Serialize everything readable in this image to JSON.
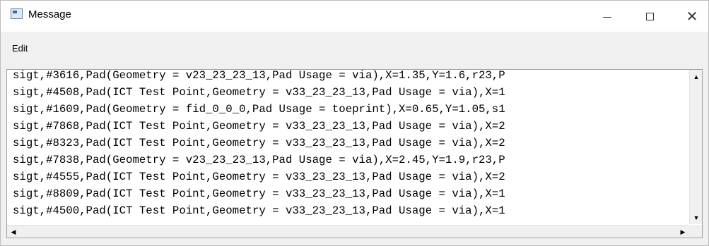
{
  "window": {
    "title": "Message",
    "app_icon": "app-window-icon",
    "controls": {
      "minimize": "minimize-icon",
      "maximize": "maximize-icon",
      "close": "close-icon"
    }
  },
  "menu": {
    "items": [
      "Edit"
    ]
  },
  "textbox": {
    "lines": [
      "sigt,#3616,Pad(Geometry = v23_23_23_13,Pad Usage = via),X=1.35,Y=1.6,r23,P",
      "sigt,#4508,Pad(ICT Test Point,Geometry = v33_23_23_13,Pad Usage = via),X=1",
      "sigt,#1609,Pad(Geometry = fid_0_0_0,Pad Usage = toeprint),X=0.65,Y=1.05,s1",
      "sigt,#7868,Pad(ICT Test Point,Geometry = v33_23_23_13,Pad Usage = via),X=2",
      "sigt,#8323,Pad(ICT Test Point,Geometry = v33_23_23_13,Pad Usage = via),X=2",
      "sigt,#7838,Pad(Geometry = v23_23_23_13,Pad Usage = via),X=2.45,Y=1.9,r23,P",
      "sigt,#4555,Pad(ICT Test Point,Geometry = v33_23_23_13,Pad Usage = via),X=2",
      "sigt,#8809,Pad(ICT Test Point,Geometry = v33_23_23_13,Pad Usage = via),X=1",
      "sigt,#4500,Pad(ICT Test Point,Geometry = v33_23_23_13,Pad Usage = via),X=1"
    ]
  }
}
